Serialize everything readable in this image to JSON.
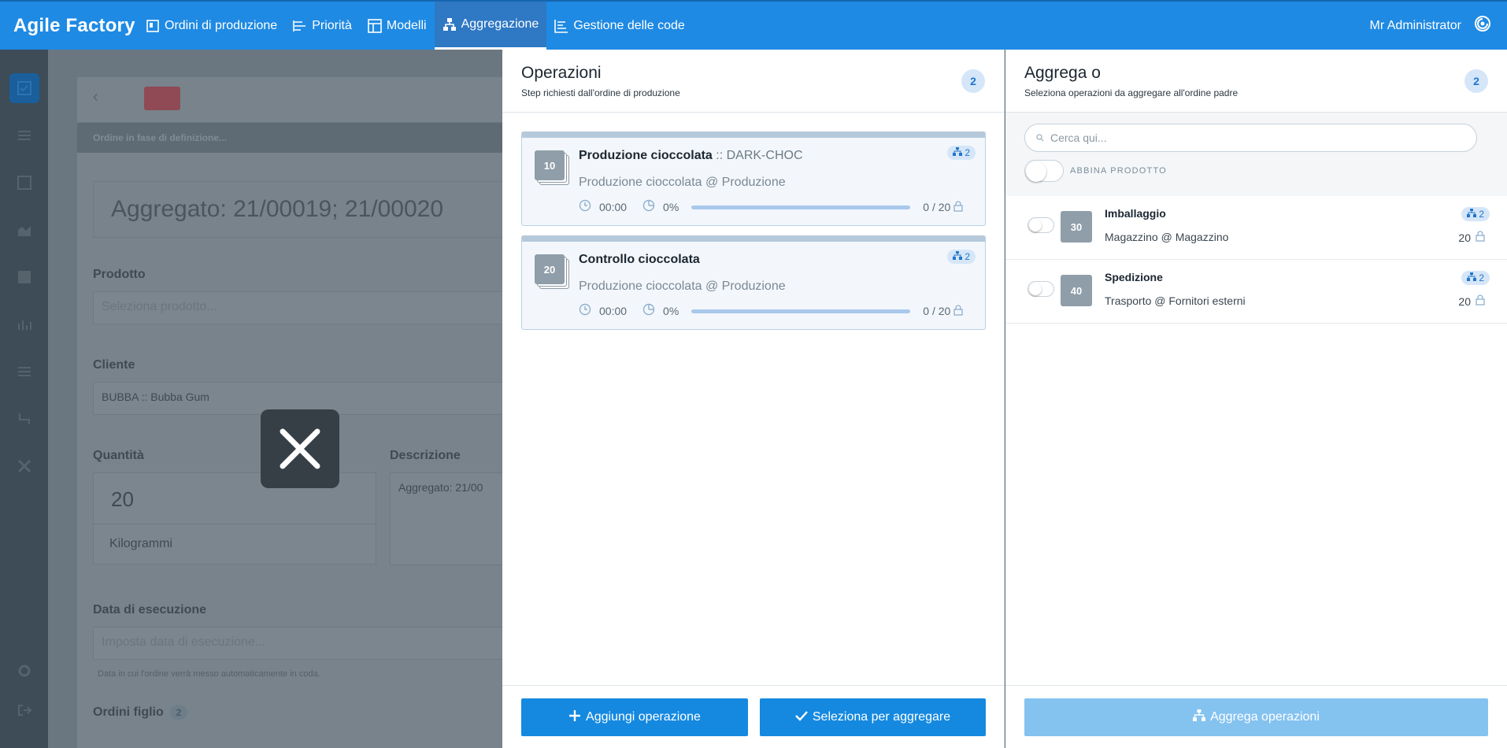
{
  "app": {
    "brand": "Agile Factory",
    "user": "Mr Administrator"
  },
  "nav": {
    "items": [
      {
        "label": "Ordini di produzione",
        "icon": "board-icon"
      },
      {
        "label": "Priorità",
        "icon": "priority-icon"
      },
      {
        "label": "Modelli",
        "icon": "template-icon"
      },
      {
        "label": "Aggregazione",
        "icon": "hierarchy-icon",
        "active": true
      },
      {
        "label": "Gestione delle code",
        "icon": "queue-icon"
      }
    ]
  },
  "background": {
    "status": "Ordine in fase di definizione...",
    "title": "Aggregato: 21/00019; 21/00020",
    "product_label": "Prodotto",
    "product_placeholder": "Seleziona prodotto...",
    "client_label": "Cliente",
    "client_value": "BUBBA :: Bubba Gum",
    "quantity_label": "Quantità",
    "quantity_value": "20",
    "unit_value": "Kilogrammi",
    "description_label": "Descrizione",
    "description_value": "Aggregato: 21/00",
    "date_label": "Data di esecuzione",
    "date_placeholder": "Imposta data di esecuzione...",
    "date_helper": "Data in cui l'ordine verrà messo automaticamente in coda.",
    "children_label": "Ordini figlio",
    "children_count": "2"
  },
  "operations_panel": {
    "title": "Operazioni",
    "subtitle": "Step richiesti dall'ordine di produzione",
    "count": "2",
    "items": [
      {
        "step": "10",
        "title": "Produzione cioccolata",
        "code": ":: DARK-CHOC",
        "sub": "Produzione cioccolata @ Produzione",
        "time": "00:00",
        "pct": "0%",
        "qty": "0 / 20",
        "chip": "2"
      },
      {
        "step": "20",
        "title": "Controllo cioccolata",
        "code": "",
        "sub": "Produzione cioccolata @ Produzione",
        "time": "00:00",
        "pct": "0%",
        "qty": "0 / 20",
        "chip": "2"
      }
    ],
    "add_button": "Aggiungi operazione",
    "select_button": "Seleziona per aggregare"
  },
  "aggregate_panel": {
    "title": "Aggrega o",
    "subtitle": "Seleziona operazioni da aggregare all'ordine padre",
    "count": "2",
    "search_placeholder": "Cerca qui...",
    "match_label": "ABBINA PRODOTTO",
    "items": [
      {
        "step": "30",
        "title": "Imballaggio",
        "sub": "Magazzino @ Magazzino",
        "chip": "2",
        "qty": "20"
      },
      {
        "step": "40",
        "title": "Spedizione",
        "sub": "Trasporto @ Fornitori esterni",
        "chip": "2",
        "qty": "20"
      }
    ],
    "aggregate_button": "Aggrega operazioni"
  },
  "colors": {
    "accent": "#1f8ae3",
    "button": "#1589e0",
    "disabled": "#84c2f0"
  }
}
